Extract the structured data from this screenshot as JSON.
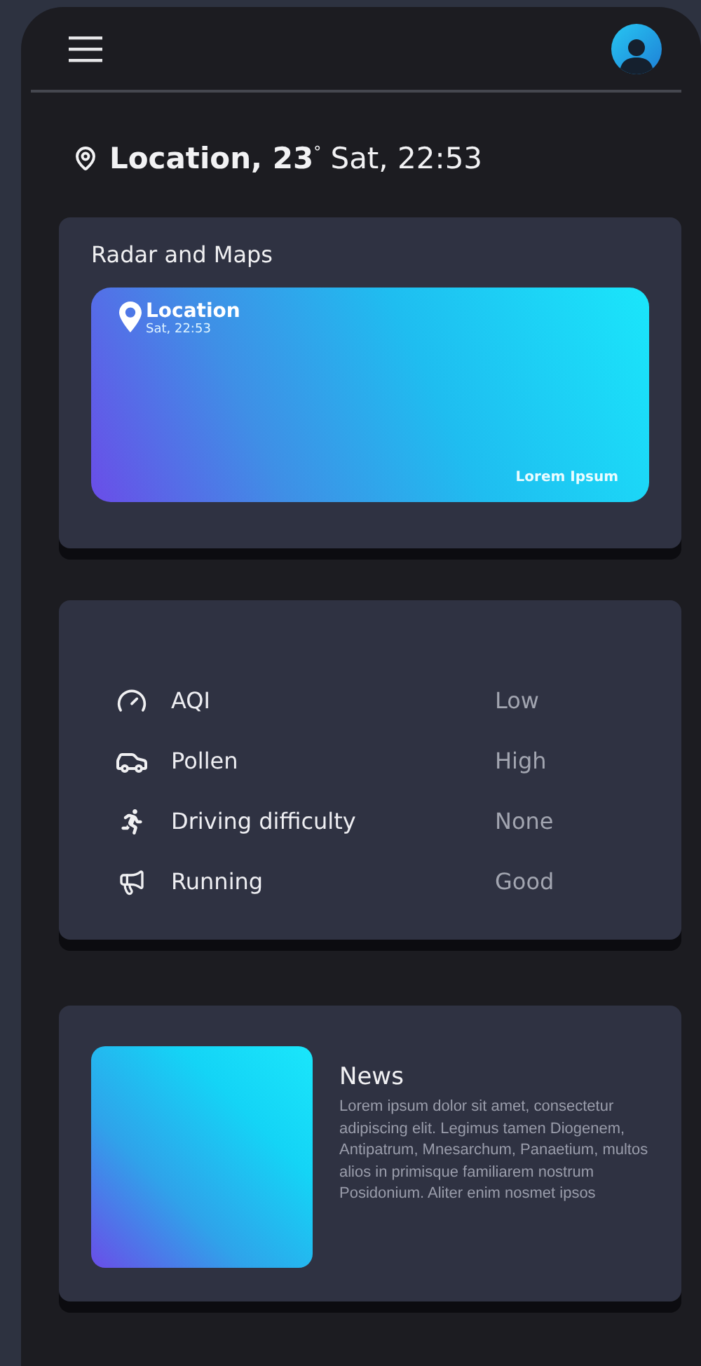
{
  "location_line": "**Location, 23**$^{°}$ Sat, 22:53",
  "radar_card": {
    "title": "Radar and Maps",
    "banner": {
      "location": "Location",
      "time": "Sat, 22:53",
      "caption": "Lorem Ipsum"
    }
  },
  "conditions": [
    {
      "kind": "gauge",
      "label": "AQI",
      "value": "Low"
    },
    {
      "kind": "car",
      "label": "Pollen",
      "value": "High"
    },
    {
      "kind": "runner",
      "label": "Driving difficulty",
      "value": "None"
    },
    {
      "kind": "megaphone",
      "label": "Running",
      "value": "Good"
    }
  ],
  "news": {
    "title": "News",
    "body": "Lorem ipsum dolor sit amet, consectetur adipiscing elit. Legimus tamen Diogenem, Antipatrum, Mnesarchum, Panaetium, multos alios in primisque familiarem nostrum Posidonium. Aliter enim nosmet ipsos"
  }
}
